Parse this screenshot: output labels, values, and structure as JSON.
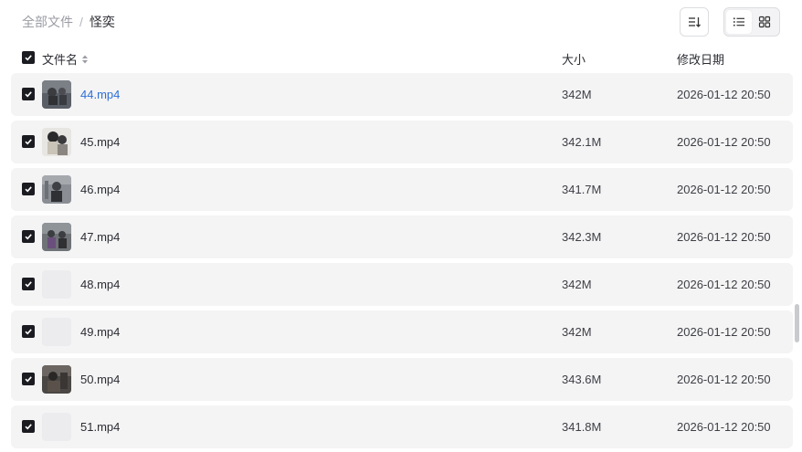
{
  "breadcrumb": {
    "root": "全部文件",
    "separator": "/",
    "current": "怪奕"
  },
  "header": {
    "name": "文件名",
    "size": "大小",
    "date": "修改日期"
  },
  "files": [
    {
      "name": "44.mp4",
      "size": "342M",
      "date": "2026-01-12 20:50",
      "thumb": "video-thumbnail",
      "highlight": true
    },
    {
      "name": "45.mp4",
      "size": "342.1M",
      "date": "2026-01-12 20:50",
      "thumb": "video-thumbnail"
    },
    {
      "name": "46.mp4",
      "size": "341.7M",
      "date": "2026-01-12 20:50",
      "thumb": "video-thumbnail"
    },
    {
      "name": "47.mp4",
      "size": "342.3M",
      "date": "2026-01-12 20:50",
      "thumb": "video-thumbnail"
    },
    {
      "name": "48.mp4",
      "size": "342M",
      "date": "2026-01-12 20:50",
      "thumb": "placeholder"
    },
    {
      "name": "49.mp4",
      "size": "342M",
      "date": "2026-01-12 20:50",
      "thumb": "placeholder"
    },
    {
      "name": "50.mp4",
      "size": "343.6M",
      "date": "2026-01-12 20:50",
      "thumb": "video-thumbnail"
    },
    {
      "name": "51.mp4",
      "size": "341.8M",
      "date": "2026-01-12 20:50",
      "thumb": "placeholder"
    }
  ],
  "colors": {
    "link": "#2e6fd6",
    "row_bg": "#f4f4f5",
    "checkbox": "#1b1c21"
  },
  "icons": {
    "sort": "sort-icon",
    "list_view": "list-view-icon",
    "grid_view": "grid-view-icon"
  }
}
